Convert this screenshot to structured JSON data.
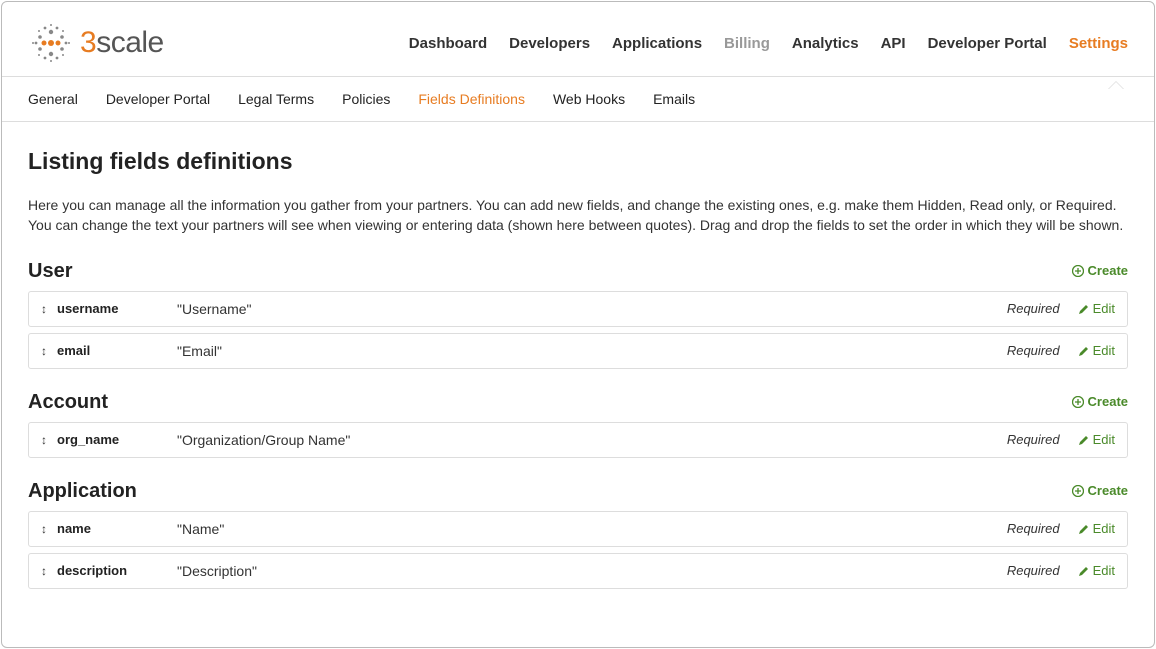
{
  "logo": {
    "brand_prefix": "3",
    "brand_rest": "scale"
  },
  "topnav": {
    "items": [
      {
        "label": "Dashboard"
      },
      {
        "label": "Developers"
      },
      {
        "label": "Applications"
      },
      {
        "label": "Billing",
        "muted": true
      },
      {
        "label": "Analytics"
      },
      {
        "label": "API"
      },
      {
        "label": "Developer Portal"
      },
      {
        "label": "Settings",
        "active": true
      }
    ]
  },
  "subnav": {
    "items": [
      {
        "label": "General"
      },
      {
        "label": "Developer Portal"
      },
      {
        "label": "Legal Terms"
      },
      {
        "label": "Policies"
      },
      {
        "label": "Fields Definitions",
        "active": true
      },
      {
        "label": "Web Hooks"
      },
      {
        "label": "Emails"
      }
    ]
  },
  "page": {
    "title": "Listing fields definitions",
    "intro": "Here you can manage all the information you gather from your partners. You can add new fields, and change the existing ones, e.g. make them Hidden, Read only, or Required. You can change the text your partners will see when viewing or entering data (shown here between quotes). Drag and drop the fields to set the order in which they will be shown."
  },
  "actions": {
    "create": "Create",
    "edit": "Edit"
  },
  "sections": [
    {
      "title": "User",
      "fields": [
        {
          "name": "username",
          "label": "\"Username\"",
          "status": "Required"
        },
        {
          "name": "email",
          "label": "\"Email\"",
          "status": "Required"
        }
      ]
    },
    {
      "title": "Account",
      "fields": [
        {
          "name": "org_name",
          "label": "\"Organization/Group Name\"",
          "status": "Required"
        }
      ]
    },
    {
      "title": "Application",
      "fields": [
        {
          "name": "name",
          "label": "\"Name\"",
          "status": "Required"
        },
        {
          "name": "description",
          "label": "\"Description\"",
          "status": "Required"
        }
      ]
    }
  ]
}
